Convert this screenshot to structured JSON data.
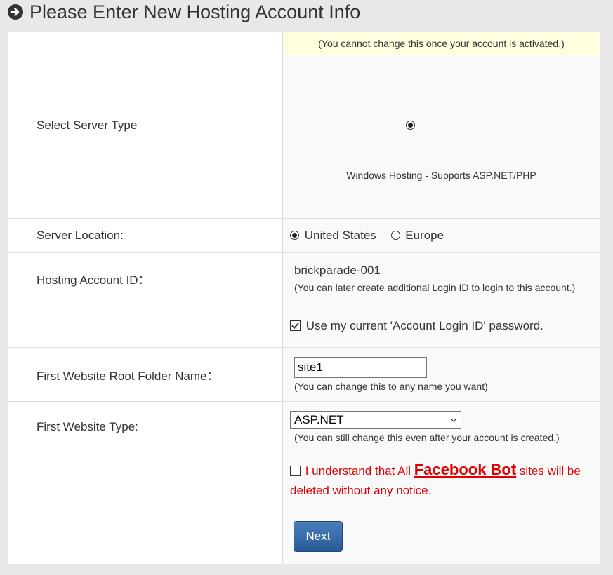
{
  "header": {
    "title": "Please Enter New Hosting Account Info",
    "icon": "circle-arrow-right-icon"
  },
  "server_type": {
    "label": "Select Server Type",
    "notice": "(You cannot change this once your account is activated.)",
    "option_label": "Windows Hosting - Supports ASP.NET/PHP",
    "selected": true
  },
  "server_location": {
    "label": "Server Location:",
    "options": [
      {
        "label": "United States",
        "selected": true
      },
      {
        "label": "Europe",
        "selected": false
      }
    ]
  },
  "account_id": {
    "label": "Hosting Account ID：",
    "value": "brickparade-001",
    "note": "(You can later create additional Login ID to login to this account.)"
  },
  "password": {
    "checkbox_label": "Use my current 'Account Login ID' password.",
    "checked": true
  },
  "root_folder": {
    "label": "First Website Root Folder Name：",
    "value": "site1",
    "note": "(You can change this to any name you want)"
  },
  "website_type": {
    "label": "First Website Type:",
    "selected": "ASP.NET",
    "note": "(You can still change this even after your account is created.)"
  },
  "agreement": {
    "text_before": "I understand that All ",
    "link_text": "Facebook Bot",
    "text_after": " sites will be deleted without any notice.",
    "checked": false,
    "color": "#e00000"
  },
  "actions": {
    "next_label": "Next"
  }
}
